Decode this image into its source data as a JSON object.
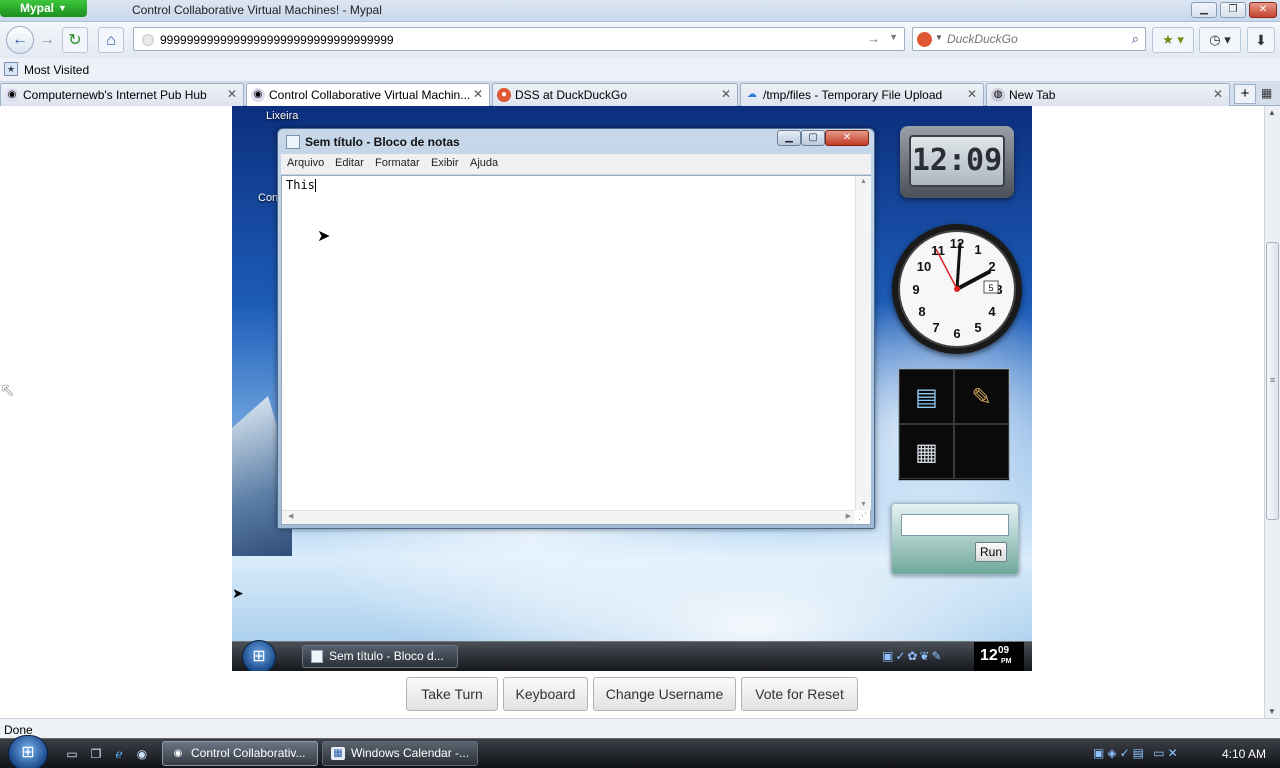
{
  "browser": {
    "app_name": "Mypal",
    "window_title": "Control Collaborative Virtual Machines! - Mypal",
    "url": "99999999999999999999999999999999999",
    "search_placeholder": "DuckDuckGo",
    "most_visited": "Most Visited",
    "tabs": [
      {
        "label": "Computernewb's Internet Pub Hub",
        "active": false
      },
      {
        "label": "Control Collaborative Virtual Machin...",
        "active": true
      },
      {
        "label": "DSS at DuckDuckGo",
        "active": false
      },
      {
        "label": "/tmp/files - Temporary File Upload",
        "active": false
      },
      {
        "label": "New Tab",
        "active": false
      }
    ],
    "status": "Done"
  },
  "vm": {
    "desktop_icon_label": "Lixeira",
    "desktop_icon2_label": "Con",
    "notepad": {
      "title": "Sem título - Bloco de notas",
      "menu": [
        "Arquivo",
        "Editar",
        "Formatar",
        "Exibir",
        "Ajuda"
      ],
      "text": "This"
    },
    "gadgets": {
      "digital_clock": "12:09",
      "analog_numbers": [
        "12",
        "1",
        "2",
        "3",
        "4",
        "5",
        "6",
        "7",
        "8",
        "9",
        "10",
        "11"
      ],
      "analog_date": "5",
      "run_button": "Run"
    },
    "taskbar": {
      "task_label": "Sem título - Bloco d...",
      "clock_hour": "12",
      "clock_minute": "09",
      "clock_ampm": "PM"
    }
  },
  "controls": {
    "take_turn": "Take Turn",
    "keyboard": "Keyboard",
    "change_username": "Change Username",
    "vote_reset": "Vote for Reset"
  },
  "host_taskbar": {
    "tasks": [
      {
        "label": "Control Collaborativ...",
        "active": true
      },
      {
        "label": "Windows Calendar -...",
        "active": false
      }
    ],
    "clock": "4:10 AM"
  },
  "colors": {
    "app_button": "#1d8f1d",
    "close_button": "#c4452f",
    "duckduckgo": "#de5833"
  }
}
